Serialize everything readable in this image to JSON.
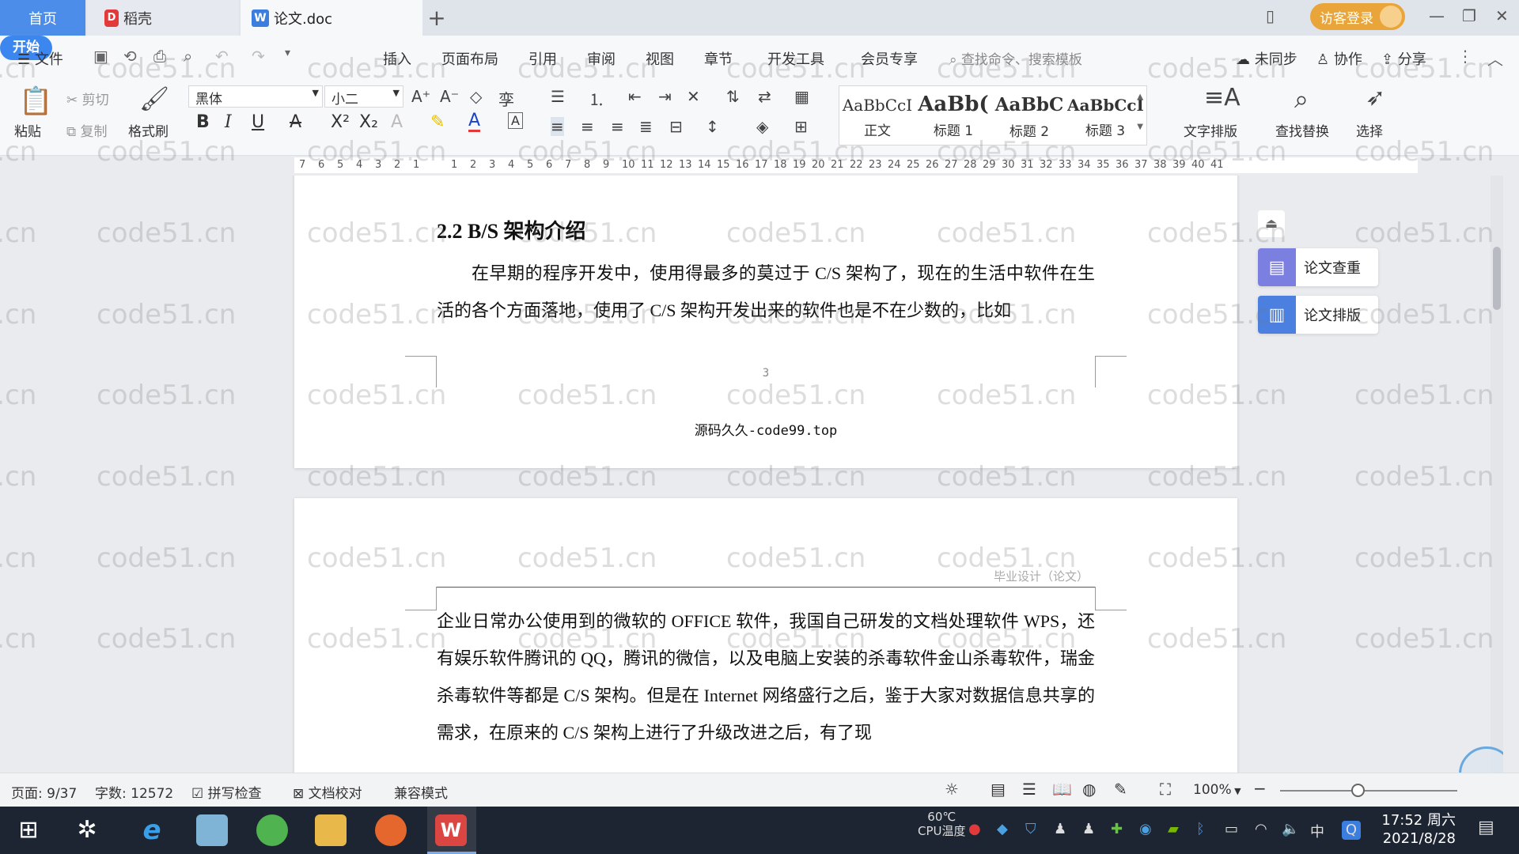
{
  "tabs": {
    "home": "首页",
    "docer": "稻壳",
    "doc": "论文.doc",
    "add": "+"
  },
  "window": {
    "visitor_login": "访客登录"
  },
  "menu": {
    "file": "文件",
    "start": "开始",
    "insert": "插入",
    "layout": "页面布局",
    "reference": "引用",
    "review": "审阅",
    "view": "视图",
    "chapter": "章节",
    "devtools": "开发工具",
    "member": "会员专享",
    "search_placeholder": "查找命令、搜索模板",
    "unsynced": "未同步",
    "collab": "协作",
    "share": "分享"
  },
  "ribbon": {
    "paste": "粘贴",
    "cut": "剪切",
    "copy": "复制",
    "format_painter": "格式刷",
    "font": "黑体",
    "size": "小二",
    "styles": [
      {
        "preview": "AaBbCcI",
        "name": "正文"
      },
      {
        "preview": "AaBb(",
        "name": "标题 1"
      },
      {
        "preview": "AaBbC",
        "name": "标题 2"
      },
      {
        "preview": "AaBbCcI",
        "name": "标题 3"
      }
    ],
    "text_layout": "文字排版",
    "find_replace": "查找替换",
    "select": "选择"
  },
  "ruler": [
    "7",
    "6",
    "5",
    "4",
    "3",
    "2",
    "1",
    "",
    "1",
    "2",
    "3",
    "4",
    "5",
    "6",
    "7",
    "8",
    "9",
    "10",
    "11",
    "12",
    "13",
    "14",
    "15",
    "16",
    "17",
    "18",
    "19",
    "20",
    "21",
    "22",
    "23",
    "24",
    "25",
    "26",
    "27",
    "28",
    "29",
    "30",
    "31",
    "32",
    "33",
    "34",
    "35",
    "36",
    "37",
    "38",
    "39",
    "40",
    "41"
  ],
  "page1": {
    "heading": "2.2 B/S 架构介绍",
    "para": "在早期的程序开发中，使用得最多的莫过于 C/S 架构了，现在的生活中软件在生活的各个方面落地，使用了 C/S 架构开发出来的软件也是不在少数的，比如",
    "page_number": "3",
    "footer": "源码久久-code99.top"
  },
  "page2": {
    "header": "毕业设计（论文）",
    "para": "企业日常办公使用到的微软的 OFFICE 软件，我国自己研发的文档处理软件 WPS，还有娱乐软件腾讯的 QQ，腾讯的微信，以及电脑上安装的杀毒软件金山杀毒软件，瑞金杀毒软件等都是 C/S 架构。但是在 Internet 网络盛行之后，鉴于大家对数据信息共享的需求，在原来的 C/S 架构上进行了升级改进之后，有了现"
  },
  "side": {
    "check": "论文查重",
    "format": "论文排版"
  },
  "watermark": "code51.cn",
  "status": {
    "page": "页面: 9/37",
    "words": "字数: 12572",
    "spell": "拼写检查",
    "proof": "文档校对",
    "compat": "兼容模式",
    "zoom": "100%"
  },
  "taskbar": {
    "temp": "60℃",
    "cpu": "CPU温度",
    "time": "17:52 周六",
    "date": "2021/8/28",
    "ime": "中"
  }
}
